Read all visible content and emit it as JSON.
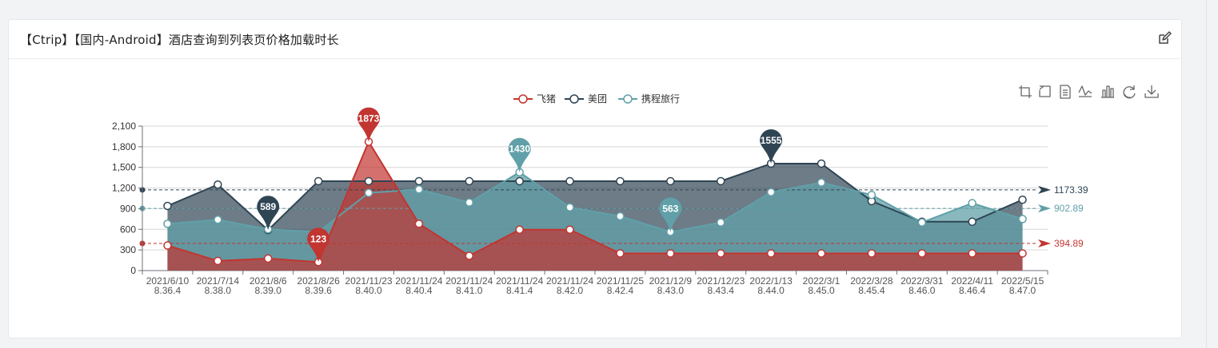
{
  "panel": {
    "title": "【Ctrip】【国内-Android】酒店查询到列表页价格加载时长"
  },
  "icons": {
    "edit": "edit-icon",
    "toolbox": [
      "zoom-in-icon",
      "zoom-reset-icon",
      "data-view-icon",
      "line-chart-icon",
      "bar-chart-icon",
      "restore-icon",
      "download-icon"
    ]
  },
  "chart_data": {
    "type": "line",
    "title": "",
    "xlabel": "",
    "ylabel": "",
    "ylim": [
      0,
      2100
    ],
    "yticks": [
      0,
      300,
      600,
      900,
      1200,
      1500,
      1800,
      2100
    ],
    "ytick_labels": [
      "0",
      "300",
      "600",
      "900",
      "1,200",
      "1,500",
      "1,800",
      "2,100"
    ],
    "grid": true,
    "legend_position": "top-center",
    "categories": [
      [
        "2021/6/10",
        "8.36.4"
      ],
      [
        "2021/7/14",
        "8.38.0"
      ],
      [
        "2021/8/6",
        "8.39.0"
      ],
      [
        "2021/8/26",
        "8.39.6"
      ],
      [
        "2021/11/23",
        "8.40.0"
      ],
      [
        "2021/11/24",
        "8.40.4"
      ],
      [
        "2021/11/24",
        "8.41.0"
      ],
      [
        "2021/11/24",
        "8.41.4"
      ],
      [
        "2021/11/24",
        "8.42.0"
      ],
      [
        "2021/11/25",
        "8.42.4"
      ],
      [
        "2021/12/9",
        "8.43.0"
      ],
      [
        "2021/12/23",
        "8.43.4"
      ],
      [
        "2022/1/13",
        "8.44.0"
      ],
      [
        "2022/3/1",
        "8.45.0"
      ],
      [
        "2022/3/28",
        "8.45.4"
      ],
      [
        "2022/3/31",
        "8.46.0"
      ],
      [
        "2022/4/11",
        "8.46.4"
      ],
      [
        "2022/5/15",
        "8.47.0"
      ]
    ],
    "series": [
      {
        "name": "飞猪",
        "color": "#c23531",
        "values": [
          365,
          140,
          175,
          123,
          1873,
          680,
          215,
          595,
          595,
          250,
          250,
          250,
          250,
          250,
          250,
          250,
          250,
          250
        ],
        "max": {
          "index": 4,
          "label": "1873"
        },
        "min": {
          "index": 3,
          "label": "123"
        },
        "average": {
          "value": 394.89,
          "label": "394.89"
        }
      },
      {
        "name": "美团",
        "color": "#2f4554",
        "values": [
          940,
          1250,
          589,
          1300,
          1300,
          1300,
          1300,
          1300,
          1300,
          1300,
          1300,
          1300,
          1555,
          1555,
          1010,
          710,
          710,
          1030
        ],
        "max": {
          "index": 12,
          "label": "1555"
        },
        "min": {
          "index": 2,
          "label": "589"
        },
        "average": {
          "value": 1173.39,
          "label": "1173.39"
        }
      },
      {
        "name": "携程旅行",
        "color": "#61a0a8",
        "values": [
          680,
          740,
          600,
          560,
          1130,
          1180,
          990,
          1430,
          920,
          790,
          563,
          700,
          1140,
          1280,
          1100,
          700,
          980,
          750
        ],
        "max": {
          "index": 7,
          "label": "1430"
        },
        "min": {
          "index": 10,
          "label": "563"
        },
        "average": {
          "value": 902.89,
          "label": "902.89"
        }
      }
    ]
  }
}
